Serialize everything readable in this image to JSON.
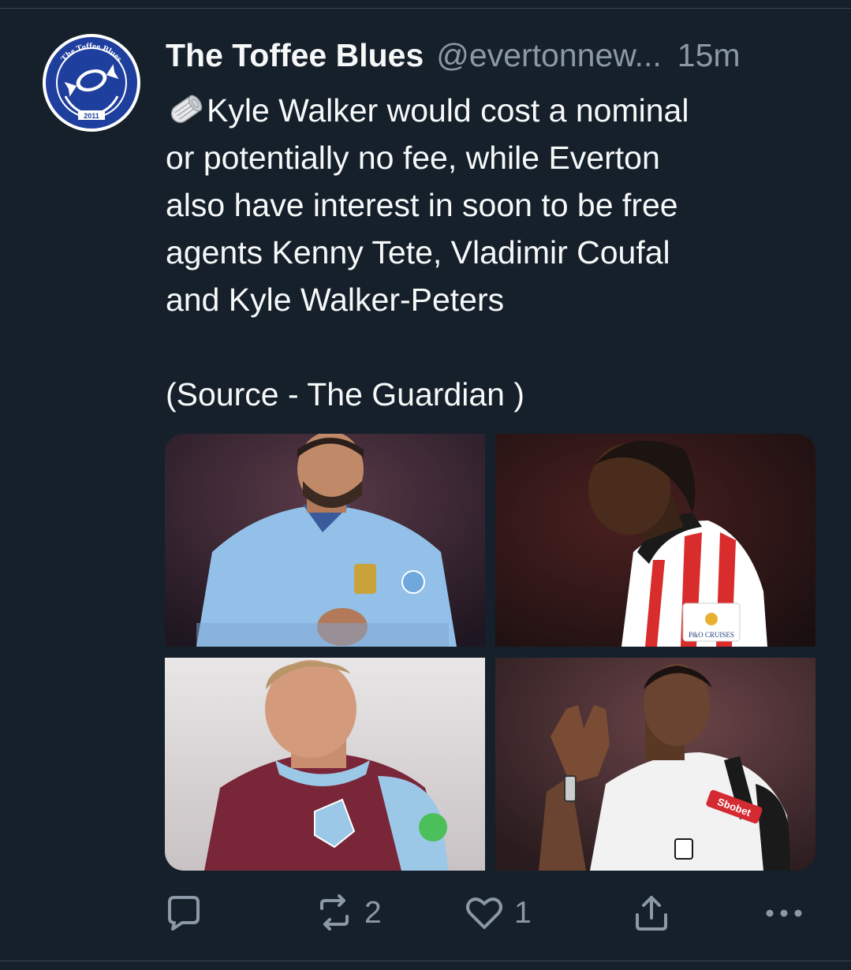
{
  "tweet": {
    "display_name": "The Toffee Blues",
    "handle": "@evertonnew...",
    "time": "15m",
    "emoji": "newspaper-roll-icon",
    "text": "Kyle Walker would cost a nominal\nor potentially no fee, while Everton\nalso have interest in soon to be free\nagents Kenny Tete, Vladimir Coufal\nand Kyle Walker-Peters\n\n(Source - The Guardian )"
  },
  "avatar": {
    "ring_text": "The Toffee Blues",
    "year": "2011",
    "accent": "#1f3f9e"
  },
  "photos": [
    {
      "subject": "player-photo-kyle-walker",
      "shirt_color": "#93c0e8"
    },
    {
      "subject": "player-photo-kyle-walker-peters",
      "shirt_color": "#d92c2c"
    },
    {
      "subject": "player-photo-vladimir-coufal",
      "shirt_color": "#7a2639"
    },
    {
      "subject": "player-photo-kenny-tete",
      "shirt_color": "#f2f2f2"
    }
  ],
  "photo_texts": {
    "sponsor_p2": "P&O CRUISES",
    "sponsor_p4": "Sbobet"
  },
  "actions": {
    "reply_icon": "reply-icon",
    "retweet_icon": "retweet-icon",
    "retweet_count": "2",
    "like_icon": "heart-icon",
    "like_count": "1",
    "share_icon": "share-icon",
    "more_icon": "more-icon"
  },
  "colors": {
    "background": "#15202b",
    "text_primary": "#f7f9f9",
    "text_secondary": "#8b98a5",
    "divider": "#38444d"
  }
}
